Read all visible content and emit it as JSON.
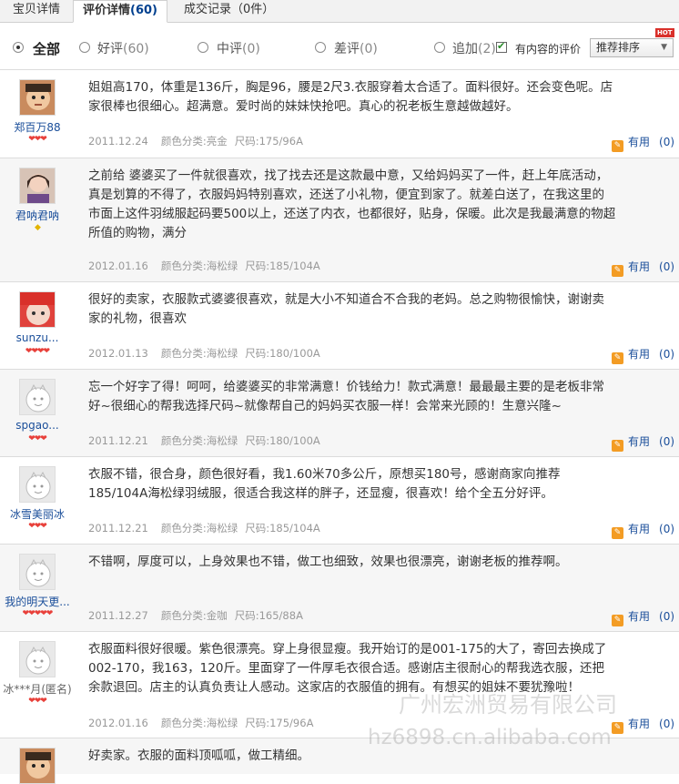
{
  "tabs": [
    {
      "label": "宝贝详情",
      "count": ""
    },
    {
      "label": "评价详情",
      "count": "(60)"
    },
    {
      "label": "成交记录",
      "count": "（0件）"
    }
  ],
  "filters": {
    "all": "全部",
    "good": "好评",
    "good_count": "(60)",
    "neutral": "中评",
    "neutral_count": "(0)",
    "bad": "差评",
    "bad_count": "(0)",
    "append": "追加",
    "append_count": "(2)",
    "with_content": "有内容的评价",
    "sort_label": "推荐排序",
    "hot_badge": "HOT"
  },
  "useful_label": "有用",
  "reviews": [
    {
      "user": "郑百万88",
      "level": "❤❤❤",
      "text": "姐姐高170，体重是136斤，胸是96，腰是2尺3.衣服穿着太合适了。面料很好。还会变色呢。店家很棒也很细心。超满意。爱时尚的妹妹快抢吧。真心的祝老板生意越做越好。",
      "date": "2011.12.24",
      "color": "颜色分类:亮金",
      "size": "尺码:175/96A",
      "useful_count": "(0)"
    },
    {
      "user": "君呐君呐",
      "level": "◆",
      "text": "之前给  婆婆买了一件就很喜欢，找了找去还是这款最中意，又给妈妈买了一件，赶上年底活动，真是划算的不得了，衣服妈妈特别喜欢，还送了小礼物，便宜到家了。就差白送了，在我这里的市面上这件羽绒服起码要500以上，还送了内衣，也都很好，贴身，保暖。此次是我最满意的物超所值的购物，满分",
      "date": "2012.01.16",
      "color": "颜色分类:海松绿",
      "size": "尺码:185/104A",
      "useful_count": "(0)"
    },
    {
      "user": "sunzu...",
      "level": "❤❤❤❤",
      "text": "很好的卖家，衣服款式婆婆很喜欢，就是大小不知道合不合我的老妈。总之购物很愉快，谢谢卖家的礼物，很喜欢",
      "date": "2012.01.13",
      "color": "颜色分类:海松绿",
      "size": "尺码:180/100A",
      "useful_count": "(0)"
    },
    {
      "user": "spgao...",
      "level": "❤❤❤",
      "text": "忘一个好字了得！呵呵，给婆婆买的非常满意！价钱给力！款式满意！最最最主要的是老板非常好~很细心的帮我选择尺码~就像帮自己的妈妈买衣服一样！会常来光顾的！生意兴隆~",
      "date": "2011.12.21",
      "color": "颜色分类:海松绿",
      "size": "尺码:180/100A",
      "useful_count": "(0)"
    },
    {
      "user": "冰雪美丽冰",
      "level": "❤❤❤",
      "text": "衣服不错，很合身，颜色很好看，我1.60米70多公斤，原想买180号，感谢商家向推荐185/104A海松绿羽绒服，很适合我这样的胖子，还显瘦，很喜欢！给个全五分好评。",
      "date": "2011.12.21",
      "color": "颜色分类:海松绿",
      "size": "尺码:185/104A",
      "useful_count": "(0)"
    },
    {
      "user": "我的明天更...",
      "level": "❤❤❤❤❤",
      "text": "不错啊，厚度可以，上身效果也不错，做工也细致，效果也很漂亮，谢谢老板的推荐啊。",
      "date": "2011.12.27",
      "color": "颜色分类:金咖",
      "size": "尺码:165/88A",
      "useful_count": "(0)"
    },
    {
      "user": "冰***月(匿名)",
      "level": "❤❤❤",
      "text": "衣服面料很好很暖。紫色很漂亮。穿上身很显瘦。我开始订的是001-175的大了，寄回去换成了002-170，我163，120斤。里面穿了一件厚毛衣很合适。感谢店主很耐心的帮我选衣服，还把余款退回。店主的认真负责让人感动。这家店的衣服值的拥有。有想买的姐妹不要犹豫啦！",
      "date": "2012.01.16",
      "color": "颜色分类:海松绿",
      "size": "尺码:175/96A",
      "useful_count": "(0)"
    },
    {
      "user": "",
      "level": "",
      "text": "好卖家。衣服的面料顶呱呱，做工精细。",
      "date": "",
      "color": "",
      "size": "",
      "useful_count": ""
    }
  ],
  "watermark": {
    "line1": "广州宏洲贸易有限公司",
    "line2": "hz6898.cn.alibaba.com"
  }
}
